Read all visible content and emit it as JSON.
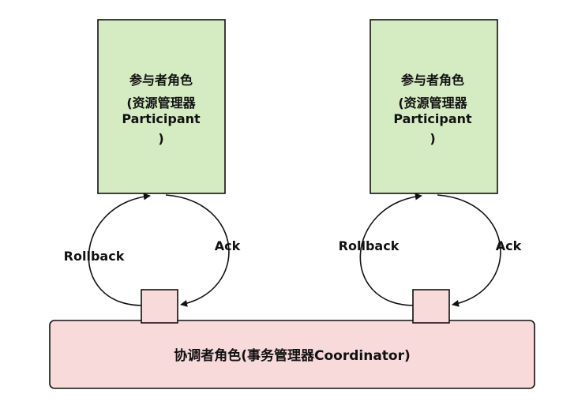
{
  "colors": {
    "participant_fill": "#d5ecc3",
    "coordinator_fill": "#f8dada",
    "port_fill": "#f8dada",
    "stroke": "#111111"
  },
  "participants": [
    {
      "lines": [
        "参与者角色",
        "(资源管理器",
        "Participant",
        ")"
      ],
      "rollback_label": "Rollback",
      "ack_label": "Ack"
    },
    {
      "lines": [
        "参与者角色",
        "(资源管理器",
        "Participant",
        ")"
      ],
      "rollback_label": "Rollback",
      "ack_label": "Ack"
    }
  ],
  "coordinator": {
    "label": "协调者角色(事务管理器Coordinator)"
  }
}
